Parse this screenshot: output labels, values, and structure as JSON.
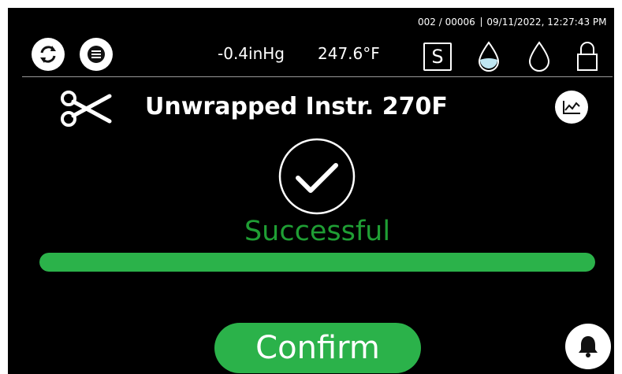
{
  "header": {
    "counter": "002 / 00006",
    "datetime": "09/11/2022, 12:27:43 PM",
    "pressure": "-0.4inHg",
    "temperature": "247.6°F",
    "mode_badge": "S",
    "icons": [
      "refresh-icon",
      "menu-icon",
      "water-filled-icon",
      "water-empty-icon",
      "lock-icon"
    ]
  },
  "cycle": {
    "title": "Unwrapped Instr. 270F",
    "status": "Successful",
    "progress_fraction": 1.0
  },
  "actions": {
    "confirm_label": "Confirm"
  },
  "colors": {
    "background": "#000000",
    "success": "#1f9e34",
    "accent_green": "#2bb24a",
    "water_fill": "#bfe6f2"
  }
}
